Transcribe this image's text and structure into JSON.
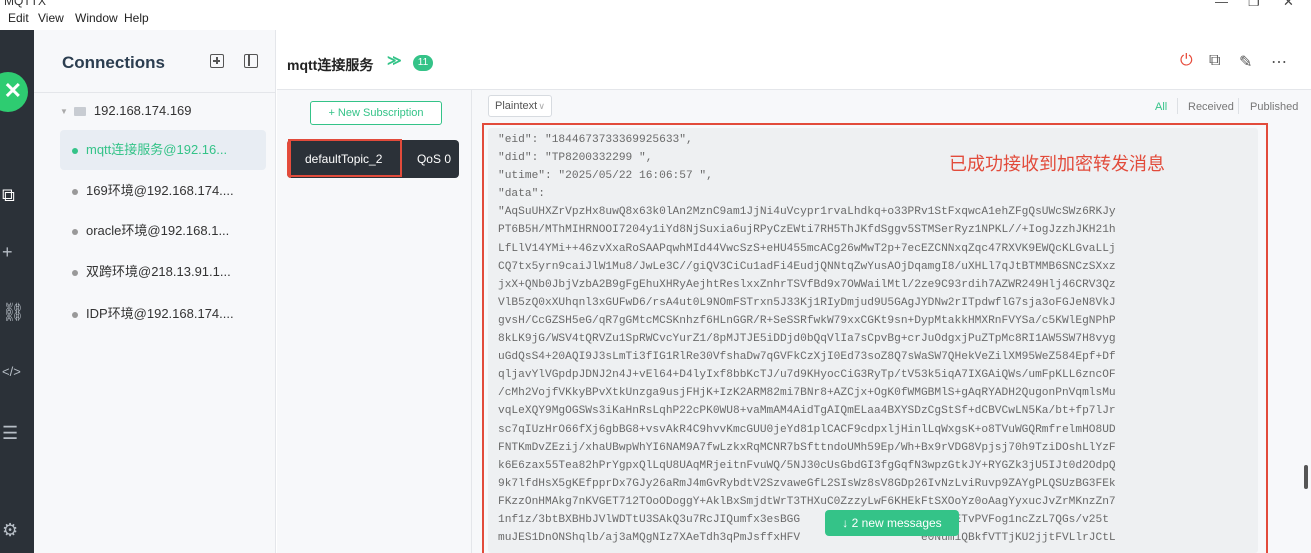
{
  "window": {
    "title": "MQTTX",
    "minimize_label": "—",
    "maximize_label": "❐",
    "close_label": "✕"
  },
  "menu": [
    "Edit",
    "View",
    "Window",
    "Help"
  ],
  "sidebar": {
    "items": [
      {
        "icon": "connections-icon",
        "glyph": "⧉"
      },
      {
        "icon": "plus-icon",
        "glyph": "+"
      },
      {
        "icon": "topology-icon",
        "glyph": "⛓"
      },
      {
        "icon": "script-icon",
        "glyph": "</>"
      },
      {
        "icon": "log-icon",
        "glyph": "☰"
      },
      {
        "icon": "settings-icon",
        "glyph": "⚙"
      }
    ]
  },
  "connections": {
    "header": "Connections",
    "group": "192.168.174.169",
    "items": [
      {
        "label": "mqtt连接服务@192.16...",
        "active": true
      },
      {
        "label": "169环境@192.168.174....",
        "active": false
      },
      {
        "label": "oracle环境@192.168.1...",
        "active": false
      },
      {
        "label": "双跨环境@218.13.91.1...",
        "active": false
      },
      {
        "label": "IDP环境@192.168.174....",
        "active": false
      }
    ]
  },
  "topbar": {
    "name": "mqtt连接服务",
    "chevron": "≫",
    "badge": "11",
    "actions": {
      "power": "⏻",
      "copy": "⧉",
      "edit": "✎",
      "more": "⋯"
    }
  },
  "subscriptions": {
    "new_label": "+ New Subscription",
    "items": [
      {
        "topic": "defaultTopic_2",
        "qos": "QoS 0"
      }
    ]
  },
  "filter": {
    "format": "Plaintext",
    "format_caret": "∨",
    "options": [
      {
        "label": "All",
        "active": true
      },
      {
        "label": "Received",
        "active": false
      },
      {
        "label": "Published",
        "active": false
      }
    ]
  },
  "message": {
    "lines": [
      "\"eid\": \"1844673733369925633\",",
      "\"did\": \"TP8200332299 \",",
      "\"utime\": \"2025/05/22 16:06:57 \",",
      "\"data\":",
      "\"AqSuUHXZrVpzHx8uwQ8x63k0lAn2MznC9am1JjNi4uVcypr1rvaLhdkq+o33PRv1StFxqwcA1ehZFgQsUWcSWz6RKJy",
      "PT6B5H/MThMIHRNOOI7204y1iYd8NjSuxia6ujRPyCzEWti7RH5ThJKfdSggv5STMSerRyz1NPKL//+IogJzzhJKH21h",
      "LfLlV14YMi++46zvXxaRoSAAPqwhMId44VwcSzS+eHU455mcACg26wMwT2p+7ecEZCNNxqZqc47RXVK9EWQcKLGvaLLj",
      "CQ7tx5yrn9caiJlW1Mu8/JwLe3C//giQV3CiCu1adFi4EudjQNNtqZwYusAOjDqamgI8/uXHLl7qJtBTMMB6SNCzSXxz",
      "jxX+QNb0JbjVzbA2B9gFgEhuXHRyAejhtReslxxZnhrTSVfBd9x7OWWailMtl/2ze9C93rdih7AZWR249Hlj46CRV3Qz",
      "VlB5zQ0xXUhqnl3xGUFwD6/rsA4ut0L9NOmFSTrxn5J33Kj1RIyDmjud9U5GAgJYDNw2rITpdwflG7sja3oFGJeN8VkJ",
      "gvsH/CcGZSH5eG/qR7gGMtcMCSKnhzf6HLnGGR/R+SeSSRfwkW79xxCGKt9sn+DypMtakkHMXRnFVYSa/c5KWlEgNPhP",
      "8kLK9jG/WSV4tQRVZu1SpRWCvcYurZ1/8pMJTJE5iDDjd0bQqVlIa7sCpvBg+crJuOdgxjPuZTpMc8RI1AW5SW7H8vyg",
      "uGdQsS4+20AQI9J3sLmTi3fIG1RlRe30VfshaDw7qGVFkCzXjI0Ed73soZ8Q7sWaSW7QHekVeZilXM95WeZ584Epf+Df",
      "qljavYlVGpdpJDNJ2n4J+vEl64+D4lyIxf8bbKcTJ/u7d9KHyocCiG3RyTp/tV53k5iqA7IXGAiQWs/umFpKLL6zncOF",
      "/cMh2VojfVKkyBPvXtkUnzga9usjFHjK+IzK2ARM82mi7BNr8+AZCjx+OgK0fWMGBMlS+gAqRYADH2QugonPnVqmlsMu",
      "vqLeXQY9MgOGSWs3iKaHnRsLqhP22cPK0WU8+vaMmAM4AidTgAIQmELaa4BXYSDzCgStSf+dCBVCwLN5Ka/bt+fp7lJr",
      "sc7qIUzHrO66fXj6gbBG8+vsvAkR4C9hvvKmcGUU0jeYd81plCACF9cdpxljHinlLqWxgsK+o8TVuWGQRmfrelmHO8UD",
      "FNTKmDvZEzij/xhaUBwpWhYI6NAM9A7fwLzkxRqMCNR7bSfttndoUMh59Ep/Wh+Bx9rVDG8Vpjsj70h9TziDOshLlYzF",
      "k6E6zax55Tea82hPrYgpxQlLqU8UAqMRjeitnFvuWQ/5NJ30cUsGbdGI3fgGqfN3wpzGtkJY+RYGZk3jU5IJt0d2OdpQ",
      "9k7lfdHsX5gKEfpprDx7GJy26aRmJ4mGvRybdtV2SzvaweGfL2SIsWz8sV8GDp26IvNzLviRuvp9ZAYgPLQSUzBG3FEk",
      "FKzzOnHMAkg7nKVGET712TOoODoggY+AklBxSmjdtWrT3THXuC0ZzzyLwF6KHEkFtSXOoYz0oAagYyxucJvZrMKnzZn7",
      "1nf1z/3btBXBHbJVlWDTtU3SAkQ3u7RcJIQumfx3esBGG                 lzTi54ETvPVFog1ncZzL7QGs/v25t",
      "muJES1DnONShqlb/aj3aMQgNIz7XAeTdh3qPmJsffxHFV                  e0Num1QBkfVTTjKU2jjtFVLlrJCtL"
    ],
    "annotation": "已成功接收到加密转发消息",
    "new_messages": "↓ 2 new messages"
  },
  "colors": {
    "accent": "#34c388",
    "rail": "#2b3138",
    "annotation": "#e24b3b"
  }
}
